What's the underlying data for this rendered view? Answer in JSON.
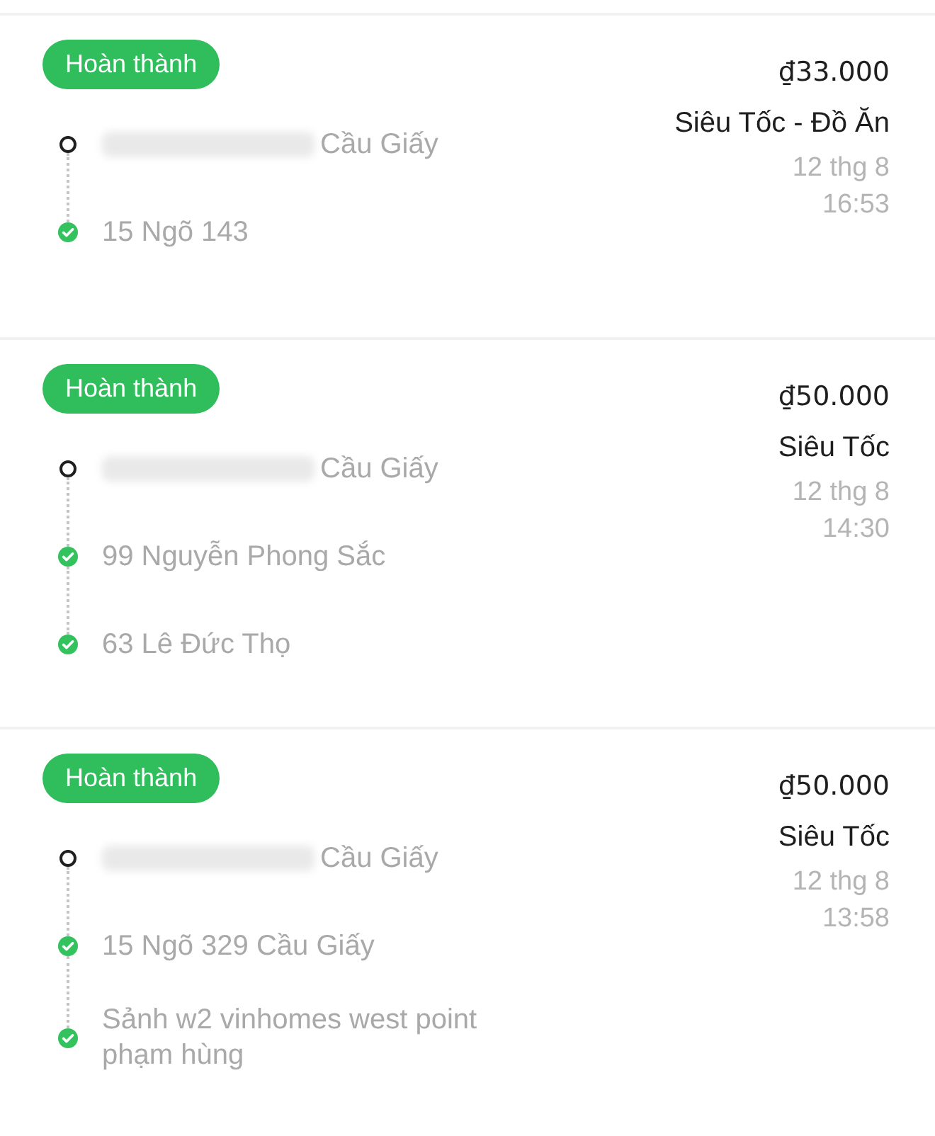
{
  "orders": [
    {
      "status": "Hoàn thành",
      "stops": [
        {
          "kind": "origin",
          "redacted": true,
          "text": "Cầu Giấy"
        },
        {
          "kind": "dropoff",
          "redacted": false,
          "text": "15 Ngõ 143"
        }
      ],
      "price": "₫33.000",
      "service": "Siêu Tốc - Đồ Ăn",
      "date": "12 thg 8",
      "time": "16:53"
    },
    {
      "status": "Hoàn thành",
      "stops": [
        {
          "kind": "origin",
          "redacted": true,
          "text": "Cầu Giấy"
        },
        {
          "kind": "dropoff",
          "redacted": false,
          "text": "99 Nguyễn Phong Sắc"
        },
        {
          "kind": "dropoff",
          "redacted": false,
          "text": "63 Lê Đức Thọ"
        }
      ],
      "price": "₫50.000",
      "service": "Siêu Tốc",
      "date": "12 thg 8",
      "time": "14:30"
    },
    {
      "status": "Hoàn thành",
      "stops": [
        {
          "kind": "origin",
          "redacted": true,
          "text": "Cầu Giấy"
        },
        {
          "kind": "dropoff",
          "redacted": false,
          "text": "15 Ngõ 329 Cầu Giấy"
        },
        {
          "kind": "dropoff",
          "redacted": false,
          "text": "Sảnh w2 vinhomes west point phạm hùng"
        }
      ],
      "price": "₫50.000",
      "service": "Siêu Tốc",
      "date": "12 thg 8",
      "time": "13:58"
    }
  ]
}
